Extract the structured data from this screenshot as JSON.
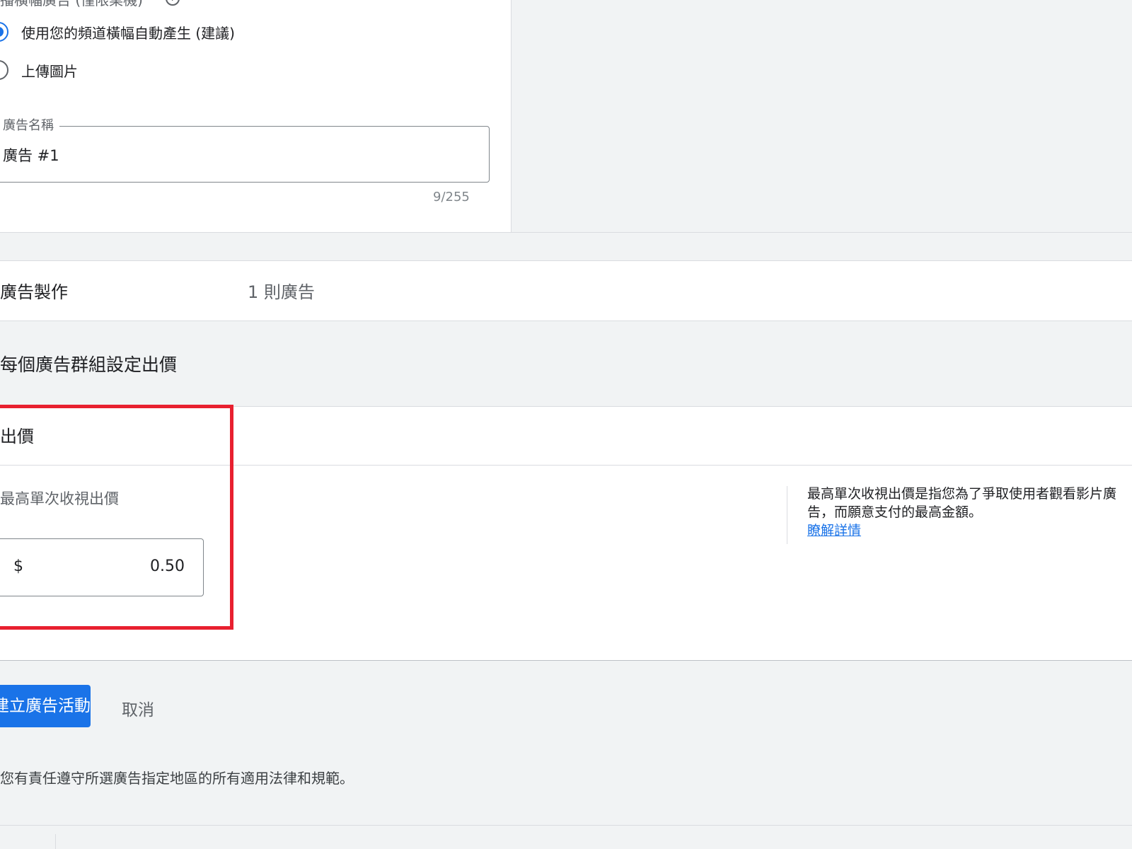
{
  "banner_ad": {
    "heading": "播橫幅廣告 (僅限桌機)",
    "options": [
      {
        "label": "使用您的頻道橫幅自動產生 (建議)",
        "selected": true
      },
      {
        "label": "上傳圖片",
        "selected": false
      }
    ]
  },
  "ad_name_field": {
    "label": "廣告名稱",
    "value": "廣告 #1",
    "counter": "9/255"
  },
  "ad_creation_summary": {
    "title": "廣告製作",
    "value": "1 則廣告"
  },
  "bid_section": {
    "heading": "每個廣告群組設定出價",
    "card_title": "出價",
    "bid_label": "最高單次收視出價",
    "currency_symbol": "$",
    "bid_value": "0.50",
    "info_text": "最高單次收視出價是指您為了爭取使用者觀看影片廣告，而願意支付的最高金額。",
    "learn_more": "瞭解詳情"
  },
  "actions": {
    "primary_label": "建立廣告活動",
    "cancel_label": "取消"
  },
  "disclaimer": "您有責任遵守所選廣告指定地區的所有適用法律和規範。",
  "colors": {
    "accent": "#1a73e8",
    "highlight": "#e8202f"
  }
}
